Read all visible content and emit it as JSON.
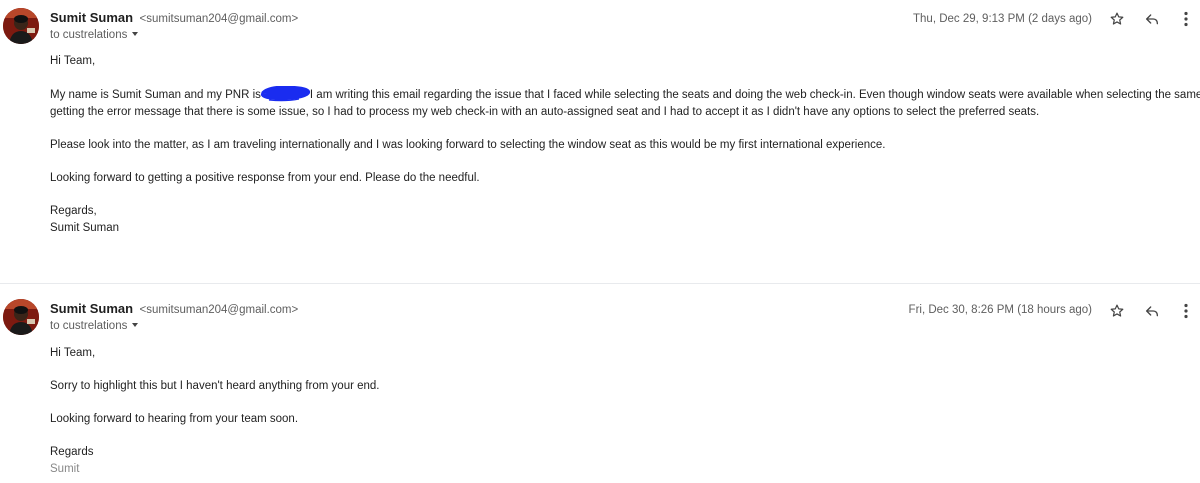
{
  "messages": [
    {
      "sender_name": "Sumit Suman",
      "sender_email": "<sumitsuman204@gmail.com>",
      "recipient_label": "to custrelations",
      "date": "Thu, Dec 29, 9:13 PM (2 days ago)",
      "greeting": "Hi Team,",
      "p1_before_redaction": "My name is Sumit Suman and my PNR is",
      "p1_line1_after_redaction": "I am writing this email regarding the issue that I faced while selecting the seats and doing the web check-in. Even though window seats were available when selecting the same, I was",
      "p1_line2": "getting the error message that there is some issue, so I had to process my web check-in with an auto-assigned seat and I had to accept it as I didn't have any options to select the preferred seats.",
      "p2": "Please look into the matter, as I am traveling internationally and I was looking forward to selecting the window seat as this would be my first international experience.",
      "p3": "Looking forward to getting a positive response from your end. Please do the needful.",
      "signoff": "Regards,",
      "signature": "Sumit Suman"
    },
    {
      "sender_name": "Sumit Suman",
      "sender_email": "<sumitsuman204@gmail.com>",
      "recipient_label": "to custrelations",
      "date": "Fri, Dec 30, 8:26 PM (18 hours ago)",
      "greeting": "Hi Team,",
      "p1": "Sorry to highlight this but I haven't heard anything from your end.",
      "p2": "Looking forward to hearing from your team soon.",
      "signoff": "Regards",
      "signature": "Sumit"
    }
  ],
  "icons": {
    "star": "star-outline-icon",
    "reply": "reply-arrow-icon",
    "more": "vertical-dots-icon",
    "avatar": "sender-avatar",
    "redaction": "redaction-scribble"
  },
  "colors": {
    "redaction": "#1a2cf0",
    "text": "#222222",
    "secondary": "#5e5e5e",
    "muted_signature": "#888888",
    "divider": "#e8eaed"
  }
}
